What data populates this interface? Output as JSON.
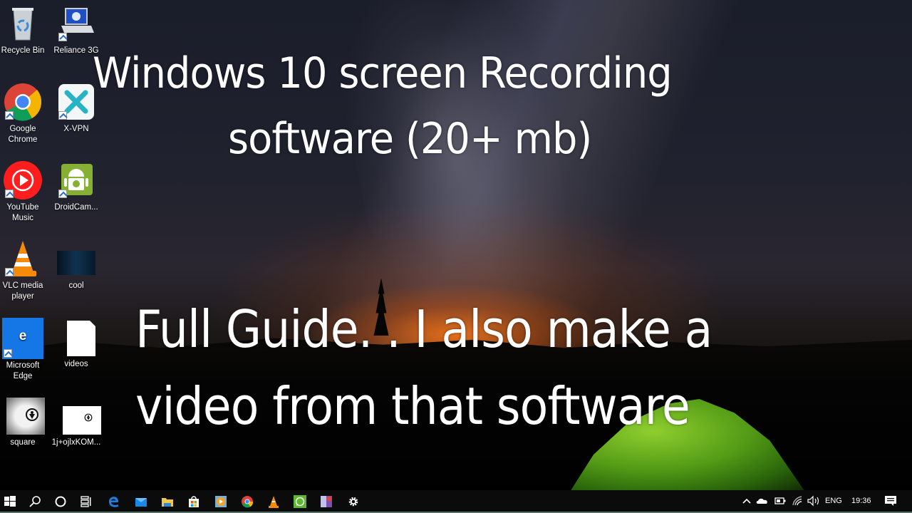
{
  "desktop": {
    "icons": [
      {
        "label": "Recycle Bin",
        "icon": "recycle-bin-icon"
      },
      {
        "label": "Reliance 3G",
        "icon": "laptop-icon"
      },
      {
        "label": "Google Chrome",
        "icon": "chrome-icon"
      },
      {
        "label": "X-VPN",
        "icon": "xvpn-icon"
      },
      {
        "label": "YouTube Music",
        "icon": "youtube-music-icon"
      },
      {
        "label": "DroidCam...",
        "icon": "droidcam-icon"
      },
      {
        "label": "VLC media player",
        "icon": "vlc-icon"
      },
      {
        "label": "cool",
        "icon": "image-thumbnail-icon"
      },
      {
        "label": "Microsoft Edge",
        "icon": "edge-icon"
      },
      {
        "label": "videos",
        "icon": "blank-file-icon"
      },
      {
        "label": "square",
        "icon": "image-thumbnail-icon"
      },
      {
        "label": "1j+ojlxKOM...",
        "icon": "image-thumbnail-icon"
      }
    ]
  },
  "overlay": {
    "line1": "Windows 10 screen Recording",
    "line2": "software (20+ mb)",
    "line3": "Full Guide. . I also make a",
    "line4": "video from that software"
  },
  "taskbar": {
    "items": [
      {
        "name": "start-button",
        "icon": "windows-logo-icon"
      },
      {
        "name": "search-button",
        "icon": "search-icon"
      },
      {
        "name": "cortana-button",
        "icon": "circle-icon"
      },
      {
        "name": "task-view-button",
        "icon": "task-view-icon"
      },
      {
        "name": "edge-taskbar",
        "icon": "edge-icon"
      },
      {
        "name": "mail-taskbar",
        "icon": "mail-icon"
      },
      {
        "name": "file-explorer-taskbar",
        "icon": "folder-icon"
      },
      {
        "name": "store-taskbar",
        "icon": "store-icon"
      },
      {
        "name": "media-player-taskbar",
        "icon": "media-player-icon"
      },
      {
        "name": "chrome-taskbar",
        "icon": "chrome-icon"
      },
      {
        "name": "vlc-taskbar",
        "icon": "vlc-icon"
      },
      {
        "name": "whatsapp-taskbar",
        "icon": "whatsapp-icon"
      },
      {
        "name": "photo-app-taskbar",
        "icon": "photo-app-icon"
      },
      {
        "name": "settings-taskbar",
        "icon": "gear-icon"
      }
    ],
    "tray": {
      "language": "ENG",
      "time": "19:36"
    }
  }
}
